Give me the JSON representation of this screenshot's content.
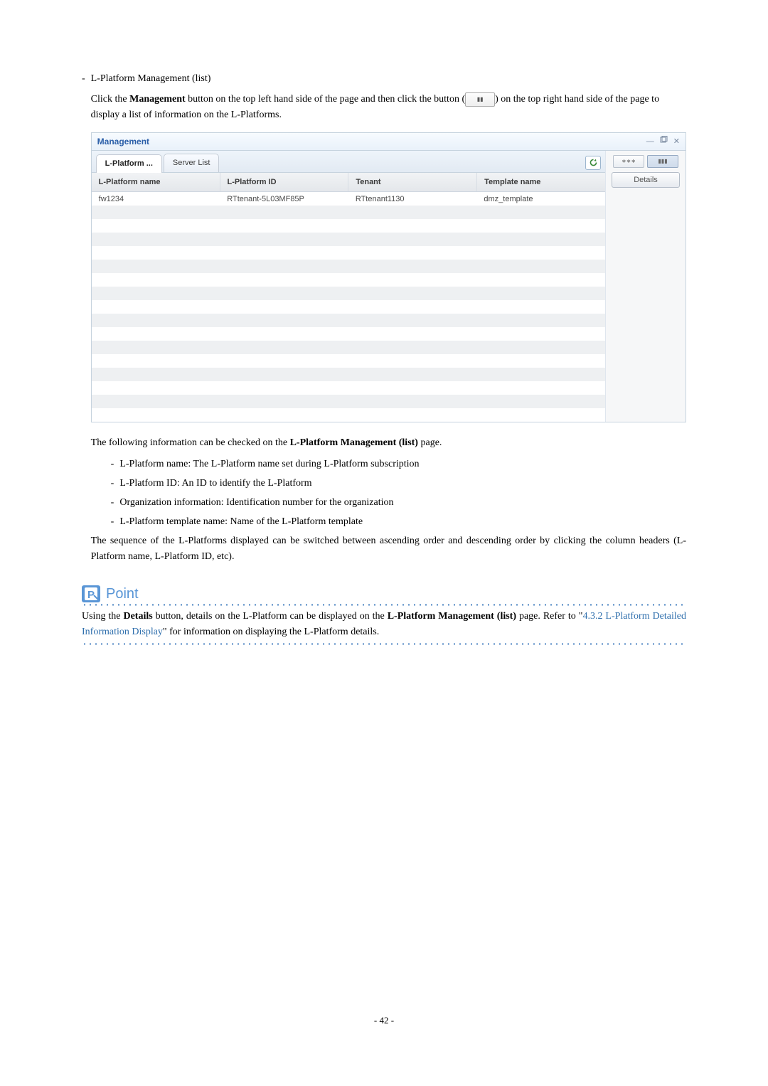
{
  "section": {
    "title": "L-Platform Management (list)",
    "intro_before": "Click the ",
    "intro_bold1": "Management",
    "intro_mid": " button on the top left hand side of the page and then click the button (",
    "intro_after": ") on the top right hand side of the page to display a list of information on the L-Platforms."
  },
  "screenshot": {
    "window_title": "Management",
    "tabs": [
      {
        "label": "L-Platform ...",
        "active": true
      },
      {
        "label": "Server List",
        "active": false
      }
    ],
    "columns": [
      "L-Platform name",
      "L-Platform ID",
      "Tenant",
      "Template name"
    ],
    "rows": [
      {
        "c0": "fw1234",
        "c1": "RTtenant-5L03MF85P",
        "c2": "RTtenant1130",
        "c3": "dmz_template"
      }
    ],
    "empty_rows": 16,
    "side": {
      "view_btns": [
        "∗∗∗",
        "▮▮▮"
      ],
      "details_label": "Details"
    },
    "inline_btn_glyph": "▮▮"
  },
  "after_text": {
    "p1_before": "The following information can be checked on the ",
    "p1_bold": "L-Platform Management (list)",
    "p1_after": " page.",
    "bullets": [
      "L-Platform name: The L-Platform name set during L-Platform subscription",
      "L-Platform ID: An ID to identify the L-Platform",
      "Organization information: Identification number for the organization",
      "L-Platform template name: Name of the L-Platform template"
    ],
    "p2": "The sequence of the L-Platforms displayed can be switched between ascending order and descending order by clicking the column headers (L-Platform name, L-Platform ID, etc)."
  },
  "point": {
    "label": "Point",
    "text_before": "Using the ",
    "text_bold1": "Details",
    "text_mid": " button, details on the L-Platform can be displayed on the ",
    "text_bold2": "L-Platform Management (list)",
    "text_mid2": " page. Refer to \"",
    "link_text": "4.3.2 L-Platform Detailed Information Display",
    "text_after": "\" for information on displaying the L-Platform details."
  },
  "page_number": "- 42 -"
}
